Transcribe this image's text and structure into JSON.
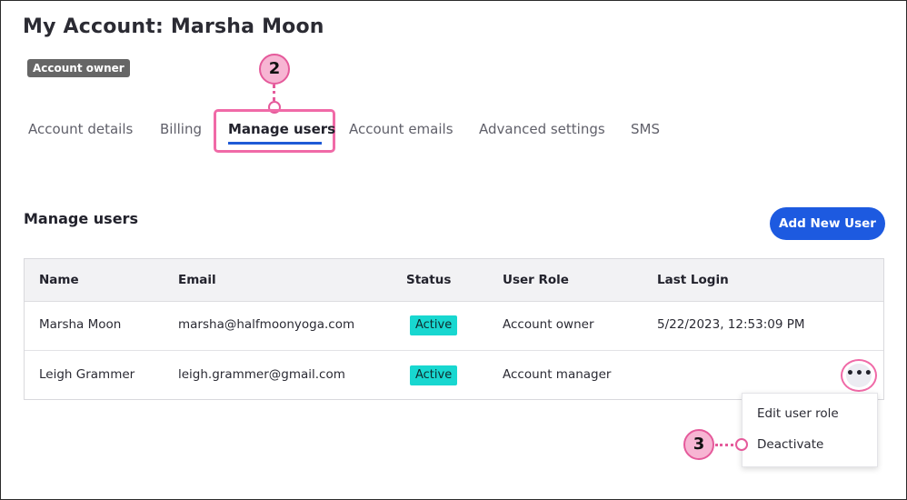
{
  "header": {
    "title": "My Account: Marsha Moon",
    "owner_badge": "Account owner"
  },
  "tabs": [
    {
      "label": "Account details"
    },
    {
      "label": "Billing"
    },
    {
      "label": "Manage users",
      "active": true
    },
    {
      "label": "Account emails"
    },
    {
      "label": "Advanced settings"
    },
    {
      "label": "SMS"
    }
  ],
  "callouts": {
    "step2": "2",
    "step3": "3"
  },
  "manage": {
    "title": "Manage users",
    "add_button": "Add New User"
  },
  "table": {
    "columns": [
      "Name",
      "Email",
      "Status",
      "User Role",
      "Last Login"
    ],
    "rows": [
      {
        "name": "Marsha Moon",
        "email": "marsha@halfmoonyoga.com",
        "status": "Active",
        "role": "Account owner",
        "last_login": "5/22/2023, 12:53:09 PM"
      },
      {
        "name": "Leigh Grammer",
        "email": "leigh.grammer@gmail.com",
        "status": "Active",
        "role": "Account manager",
        "last_login": ""
      }
    ]
  },
  "row_menu": {
    "more_label": "•••",
    "items": [
      "Edit user role",
      "Deactivate"
    ]
  },
  "colors": {
    "accent": "#1d5ae0",
    "highlight": "#f06aa7",
    "status_active": "#18d7d0"
  }
}
